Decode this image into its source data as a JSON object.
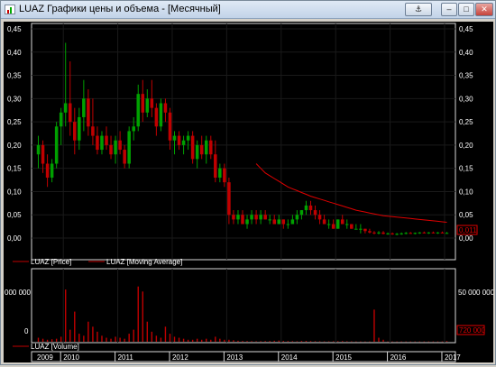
{
  "window": {
    "title": "LUAZ Графики цены и объема - [Месячный]",
    "buttons": {
      "anchor": "⚓",
      "minimize": "–",
      "maximize": "□",
      "close": "✕"
    }
  },
  "colors": {
    "background": "#000000",
    "up_candle": "#00a000",
    "down_candle": "#c00000",
    "moving_average": "#e00000",
    "volume": "#c00000",
    "axis_text": "#ffffff"
  },
  "price_panel": {
    "y_ticks": [
      "0,00",
      "0,05",
      "0,10",
      "0,15",
      "0,20",
      "0,25",
      "0,30",
      "0,35",
      "0,40",
      "0,45"
    ],
    "last_value_label": "0,011",
    "legend": [
      {
        "label": "LUAZ [Price]",
        "color": "#c00000"
      },
      {
        "label": "LUAZ [Moving Average]",
        "color": "#c00000"
      }
    ]
  },
  "volume_panel": {
    "left_tick": "000 000",
    "left_zero": "0",
    "right_tick": "50 000 000",
    "right_zero": "0",
    "last_value_label": "720 000",
    "legend": [
      {
        "label": "LUAZ [Volume]",
        "color": "#c00000"
      }
    ]
  },
  "year_axis": [
    "2009",
    "2010",
    "2011",
    "2012",
    "2013",
    "2014",
    "2015",
    "2016",
    "2017"
  ],
  "chart_data": {
    "type": "candlestick",
    "title": "LUAZ Графики цены и объема - [Месячный]",
    "period": "monthly",
    "x_start": "2009-07",
    "ylim": [
      0,
      0.45
    ],
    "ohlc": [
      [
        0.18,
        0.22,
        0.15,
        0.2
      ],
      [
        0.2,
        0.21,
        0.14,
        0.16
      ],
      [
        0.16,
        0.18,
        0.11,
        0.13
      ],
      [
        0.13,
        0.17,
        0.12,
        0.16
      ],
      [
        0.16,
        0.25,
        0.15,
        0.24
      ],
      [
        0.24,
        0.28,
        0.2,
        0.27
      ],
      [
        0.27,
        0.42,
        0.24,
        0.29
      ],
      [
        0.29,
        0.38,
        0.22,
        0.25
      ],
      [
        0.25,
        0.28,
        0.18,
        0.21
      ],
      [
        0.21,
        0.28,
        0.19,
        0.26
      ],
      [
        0.26,
        0.34,
        0.23,
        0.3
      ],
      [
        0.3,
        0.32,
        0.22,
        0.24
      ],
      [
        0.24,
        0.3,
        0.2,
        0.22
      ],
      [
        0.22,
        0.24,
        0.18,
        0.19
      ],
      [
        0.19,
        0.23,
        0.18,
        0.22
      ],
      [
        0.22,
        0.24,
        0.19,
        0.2
      ],
      [
        0.2,
        0.22,
        0.17,
        0.18
      ],
      [
        0.18,
        0.22,
        0.16,
        0.21
      ],
      [
        0.21,
        0.23,
        0.18,
        0.19
      ],
      [
        0.19,
        0.2,
        0.15,
        0.16
      ],
      [
        0.16,
        0.24,
        0.15,
        0.23
      ],
      [
        0.23,
        0.26,
        0.21,
        0.24
      ],
      [
        0.24,
        0.33,
        0.23,
        0.31
      ],
      [
        0.31,
        0.34,
        0.25,
        0.27
      ],
      [
        0.27,
        0.32,
        0.26,
        0.3
      ],
      [
        0.3,
        0.34,
        0.26,
        0.28
      ],
      [
        0.28,
        0.29,
        0.22,
        0.24
      ],
      [
        0.24,
        0.3,
        0.23,
        0.29
      ],
      [
        0.29,
        0.3,
        0.25,
        0.27
      ],
      [
        0.27,
        0.28,
        0.19,
        0.21
      ],
      [
        0.21,
        0.23,
        0.18,
        0.22
      ],
      [
        0.22,
        0.23,
        0.19,
        0.2
      ],
      [
        0.2,
        0.22,
        0.18,
        0.21
      ],
      [
        0.21,
        0.23,
        0.19,
        0.22
      ],
      [
        0.22,
        0.23,
        0.16,
        0.17
      ],
      [
        0.17,
        0.21,
        0.15,
        0.2
      ],
      [
        0.2,
        0.22,
        0.17,
        0.18
      ],
      [
        0.18,
        0.22,
        0.16,
        0.21
      ],
      [
        0.21,
        0.22,
        0.17,
        0.18
      ],
      [
        0.18,
        0.21,
        0.12,
        0.13
      ],
      [
        0.13,
        0.16,
        0.12,
        0.15
      ],
      [
        0.15,
        0.16,
        0.11,
        0.12
      ],
      [
        0.12,
        0.13,
        0.03,
        0.05
      ],
      [
        0.05,
        0.06,
        0.03,
        0.04
      ],
      [
        0.04,
        0.06,
        0.03,
        0.05
      ],
      [
        0.05,
        0.06,
        0.03,
        0.03
      ],
      [
        0.03,
        0.05,
        0.02,
        0.04
      ],
      [
        0.04,
        0.06,
        0.03,
        0.05
      ],
      [
        0.05,
        0.06,
        0.03,
        0.04
      ],
      [
        0.04,
        0.06,
        0.03,
        0.05
      ],
      [
        0.05,
        0.06,
        0.04,
        0.04
      ],
      [
        0.04,
        0.05,
        0.03,
        0.04
      ],
      [
        0.04,
        0.05,
        0.03,
        0.03
      ],
      [
        0.03,
        0.05,
        0.03,
        0.04
      ],
      [
        0.04,
        0.04,
        0.02,
        0.03
      ],
      [
        0.03,
        0.04,
        0.02,
        0.03
      ],
      [
        0.03,
        0.05,
        0.03,
        0.04
      ],
      [
        0.04,
        0.06,
        0.03,
        0.05
      ],
      [
        0.05,
        0.06,
        0.04,
        0.06
      ],
      [
        0.06,
        0.08,
        0.05,
        0.07
      ],
      [
        0.07,
        0.08,
        0.05,
        0.06
      ],
      [
        0.06,
        0.07,
        0.04,
        0.05
      ],
      [
        0.05,
        0.06,
        0.03,
        0.04
      ],
      [
        0.04,
        0.05,
        0.03,
        0.03
      ],
      [
        0.03,
        0.04,
        0.02,
        0.03
      ],
      [
        0.03,
        0.04,
        0.02,
        0.02
      ],
      [
        0.02,
        0.04,
        0.02,
        0.04
      ],
      [
        0.04,
        0.05,
        0.03,
        0.03
      ],
      [
        0.03,
        0.04,
        0.02,
        0.03
      ],
      [
        0.03,
        0.03,
        0.02,
        0.02
      ],
      [
        0.02,
        0.03,
        0.02,
        0.02
      ],
      [
        0.02,
        0.03,
        0.01,
        0.02
      ],
      [
        0.02,
        0.02,
        0.01,
        0.015
      ],
      [
        0.015,
        0.02,
        0.01,
        0.012
      ],
      [
        0.012,
        0.015,
        0.008,
        0.01
      ],
      [
        0.01,
        0.015,
        0.008,
        0.012
      ],
      [
        0.012,
        0.015,
        0.008,
        0.009
      ],
      [
        0.009,
        0.012,
        0.007,
        0.01
      ],
      [
        0.01,
        0.012,
        0.007,
        0.008
      ],
      [
        0.008,
        0.011,
        0.006,
        0.009
      ],
      [
        0.009,
        0.012,
        0.007,
        0.01
      ],
      [
        0.01,
        0.013,
        0.008,
        0.011
      ],
      [
        0.011,
        0.013,
        0.009,
        0.01
      ],
      [
        0.01,
        0.012,
        0.008,
        0.011
      ],
      [
        0.011,
        0.013,
        0.009,
        0.012
      ],
      [
        0.012,
        0.014,
        0.01,
        0.011
      ],
      [
        0.011,
        0.013,
        0.009,
        0.012
      ],
      [
        0.012,
        0.014,
        0.01,
        0.011
      ],
      [
        0.011,
        0.013,
        0.009,
        0.012
      ],
      [
        0.012,
        0.014,
        0.01,
        0.011
      ],
      [
        0.011,
        0.013,
        0.009,
        0.011
      ]
    ],
    "moving_average": {
      "start_index": 48,
      "values": [
        0.16,
        0.15,
        0.14,
        0.134,
        0.128,
        0.122,
        0.116,
        0.11,
        0.106,
        0.102,
        0.098,
        0.094,
        0.09,
        0.087,
        0.084,
        0.081,
        0.078,
        0.075,
        0.072,
        0.069,
        0.066,
        0.063,
        0.06,
        0.058,
        0.056,
        0.054,
        0.052,
        0.05,
        0.048,
        0.047,
        0.046,
        0.045,
        0.044,
        0.043,
        0.042,
        0.041,
        0.04,
        0.039,
        0.038,
        0.037,
        0.036,
        0.035,
        0.034
      ]
    },
    "volume_ylim": [
      0,
      70000000
    ],
    "volume": [
      4000000,
      3000000,
      2000000,
      2500000,
      3000000,
      5000000,
      52000000,
      12000000,
      30000000,
      8000000,
      6000000,
      20000000,
      15000000,
      10000000,
      6000000,
      4000000,
      3000000,
      5000000,
      4000000,
      3000000,
      8000000,
      12000000,
      55000000,
      50000000,
      20000000,
      10000000,
      6000000,
      4000000,
      15000000,
      8000000,
      5000000,
      4000000,
      3000000,
      2000000,
      2000000,
      3000000,
      2000000,
      3000000,
      2000000,
      5000000,
      3000000,
      2000000,
      2000000,
      1500000,
      1000000,
      800000,
      700000,
      600000,
      500000,
      600000,
      700000,
      800000,
      1000000,
      1200000,
      800000,
      700000,
      600000,
      500000,
      800000,
      900000,
      700000,
      600000,
      500000,
      400000,
      400000,
      500000,
      600000,
      700000,
      500000,
      400000,
      300000,
      300000,
      300000,
      300000,
      32000000,
      4000000,
      2000000,
      300000,
      300000,
      300000,
      300000,
      300000,
      300000,
      300000,
      300000,
      300000,
      300000,
      300000,
      300000,
      300000,
      720000
    ]
  }
}
